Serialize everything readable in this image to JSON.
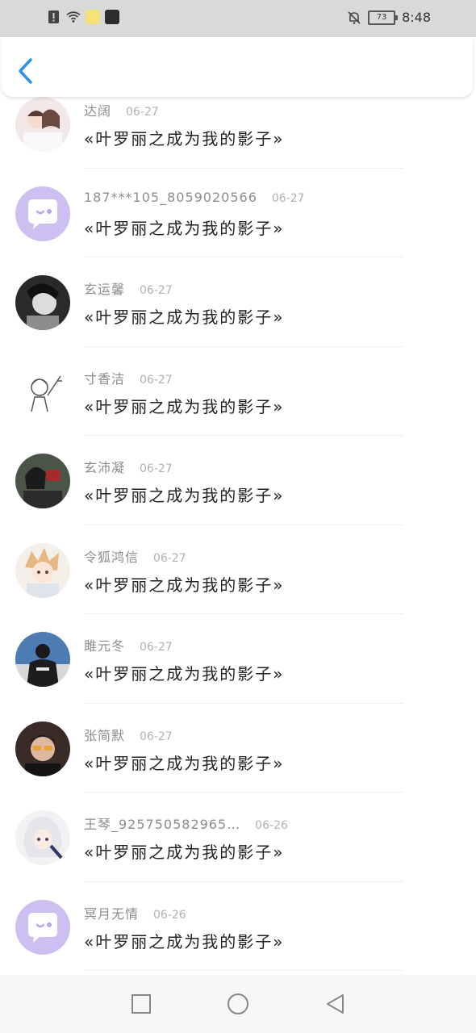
{
  "status_bar": {
    "time": "8:48",
    "battery": "73",
    "icons": [
      "alert-icon",
      "wifi-icon",
      "app-thumb-1",
      "app-thumb-2",
      "bell-off-icon",
      "battery-icon"
    ]
  },
  "header": {
    "back_icon": "chevron-left-icon",
    "accent": "#2f8ee8"
  },
  "comments": [
    {
      "name": "达阔",
      "date": "06-27",
      "text": "«叶罗丽之成为我的影子»",
      "avatar": "photo"
    },
    {
      "name": "187***105_8059020566",
      "date": "06-27",
      "text": "«叶罗丽之成为我的影子»",
      "avatar": "default-chat"
    },
    {
      "name": "玄运馨",
      "date": "06-27",
      "text": "«叶罗丽之成为我的影子»",
      "avatar": "photo"
    },
    {
      "name": "寸香洁",
      "date": "06-27",
      "text": "«叶罗丽之成为我的影子»",
      "avatar": "sketch"
    },
    {
      "name": "玄沛凝",
      "date": "06-27",
      "text": "«叶罗丽之成为我的影子»",
      "avatar": "photo"
    },
    {
      "name": "令狐鸿信",
      "date": "06-27",
      "text": "«叶罗丽之成为我的影子»",
      "avatar": "anime"
    },
    {
      "name": "雎元冬",
      "date": "06-27",
      "text": "«叶罗丽之成为我的影子»",
      "avatar": "photo"
    },
    {
      "name": "张简默",
      "date": "06-27",
      "text": "«叶罗丽之成为我的影子»",
      "avatar": "photo"
    },
    {
      "name": "王琴_925750582965…",
      "date": "06-26",
      "text": "«叶罗丽之成为我的影子»",
      "avatar": "anime"
    },
    {
      "name": "冥月无情",
      "date": "06-26",
      "text": "«叶罗丽之成为我的影子»",
      "avatar": "default-chat"
    }
  ],
  "bottom_nav": [
    "recent-apps-icon",
    "home-icon",
    "back-triangle-icon"
  ]
}
